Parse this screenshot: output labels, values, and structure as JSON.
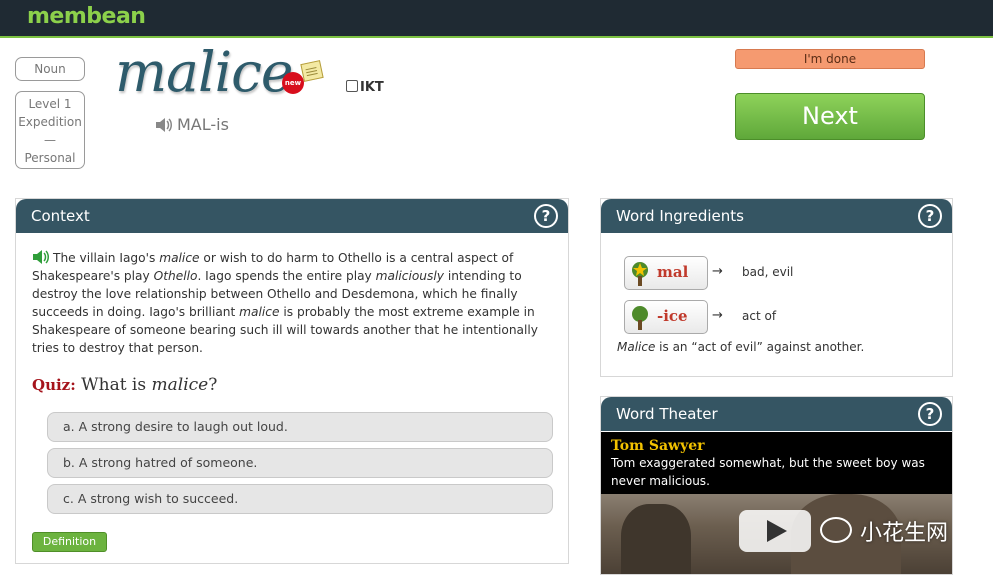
{
  "app": {
    "logo": "membean"
  },
  "word_info": {
    "part_of_speech": "Noun",
    "level_lines": [
      "Level 1",
      "Expedition",
      "—",
      "Personal"
    ],
    "word": "malice",
    "new_badge": "new",
    "ikt_label": "IKT",
    "pronunciation": "MAL-is"
  },
  "actions": {
    "done_label": "I'm done",
    "next_label": "Next"
  },
  "context": {
    "title": "Context",
    "help": "?",
    "text_parts": [
      "The villain Iago's ",
      "malice",
      " or wish to do harm to Othello is a central aspect of Shakespeare's play ",
      "Othello",
      ". Iago spends the entire play ",
      "maliciously",
      " intending to destroy the love relationship between Othello and Desdemona, which he finally succeeds in doing. Iago's brilliant ",
      "malice",
      " is probably the most extreme example in Shakespeare of someone bearing such ill will towards another that he intentionally tries to destroy that person."
    ],
    "quiz_label": "Quiz:",
    "quiz_question_pre": "What is ",
    "quiz_question_word": "malice",
    "quiz_question_post": "?",
    "options": [
      "a. A strong desire to laugh out loud.",
      "b. A strong hatred of someone.",
      "c. A strong wish to succeed."
    ],
    "definition_button": "Definition"
  },
  "ingredients": {
    "title": "Word Ingredients",
    "help": "?",
    "items": [
      {
        "part": "mal",
        "arrow": "→",
        "meaning": "bad, evil"
      },
      {
        "part": "-ice",
        "arrow": "→",
        "meaning": "act of"
      }
    ],
    "summary_word": "Malice",
    "summary_rest": " is an “act of evil” against another."
  },
  "theater": {
    "title": "Word Theater",
    "help": "?",
    "source": "Tom Sawyer",
    "line": "Tom exaggerated somewhat, but the sweet boy was never malicious."
  },
  "watermark": "小花生网"
}
